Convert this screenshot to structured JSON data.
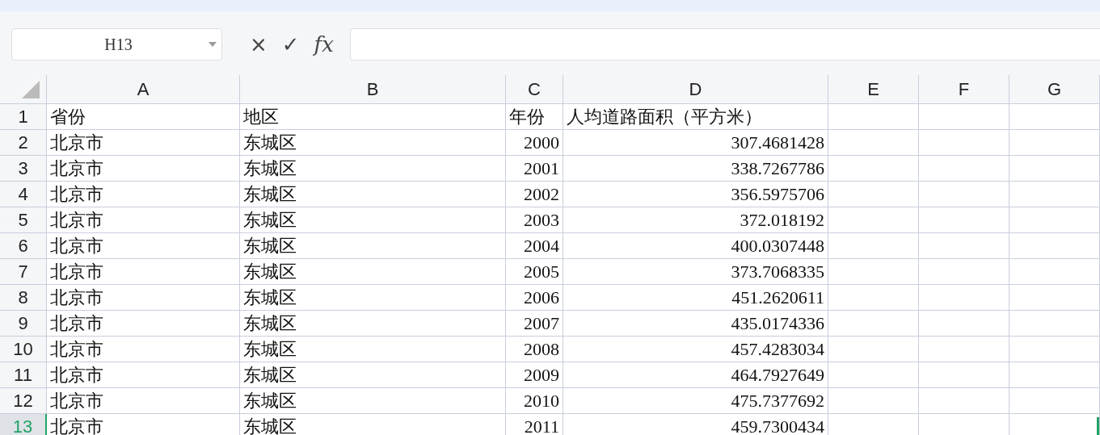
{
  "name_box": {
    "value": "H13"
  },
  "formula_bar": {
    "cancel": "×",
    "confirm": "✓",
    "fx": "fx"
  },
  "columns": [
    "A",
    "B",
    "C",
    "D",
    "E",
    "F",
    "G"
  ],
  "rows": [
    {
      "number": "1",
      "selected": false,
      "cells": [
        "省份",
        "地区",
        "年份",
        "人均道路面积（平方米）"
      ]
    },
    {
      "number": "2",
      "selected": false,
      "cells": [
        "北京市",
        "东城区",
        "2000",
        "307.4681428"
      ]
    },
    {
      "number": "3",
      "selected": false,
      "cells": [
        "北京市",
        "东城区",
        "2001",
        "338.7267786"
      ]
    },
    {
      "number": "4",
      "selected": false,
      "cells": [
        "北京市",
        "东城区",
        "2002",
        "356.5975706"
      ]
    },
    {
      "number": "5",
      "selected": false,
      "cells": [
        "北京市",
        "东城区",
        "2003",
        "372.018192"
      ]
    },
    {
      "number": "6",
      "selected": false,
      "cells": [
        "北京市",
        "东城区",
        "2004",
        "400.0307448"
      ]
    },
    {
      "number": "7",
      "selected": false,
      "cells": [
        "北京市",
        "东城区",
        "2005",
        "373.7068335"
      ]
    },
    {
      "number": "8",
      "selected": false,
      "cells": [
        "北京市",
        "东城区",
        "2006",
        "451.2620611"
      ]
    },
    {
      "number": "9",
      "selected": false,
      "cells": [
        "北京市",
        "东城区",
        "2007",
        "435.0174336"
      ]
    },
    {
      "number": "10",
      "selected": false,
      "cells": [
        "北京市",
        "东城区",
        "2008",
        "457.4283034"
      ]
    },
    {
      "number": "11",
      "selected": false,
      "cells": [
        "北京市",
        "东城区",
        "2009",
        "464.7927649"
      ]
    },
    {
      "number": "12",
      "selected": false,
      "cells": [
        "北京市",
        "东城区",
        "2010",
        "475.7377692"
      ]
    },
    {
      "number": "13",
      "selected": true,
      "cells": [
        "北京市",
        "东城区",
        "2011",
        "459.7300434"
      ]
    }
  ]
}
